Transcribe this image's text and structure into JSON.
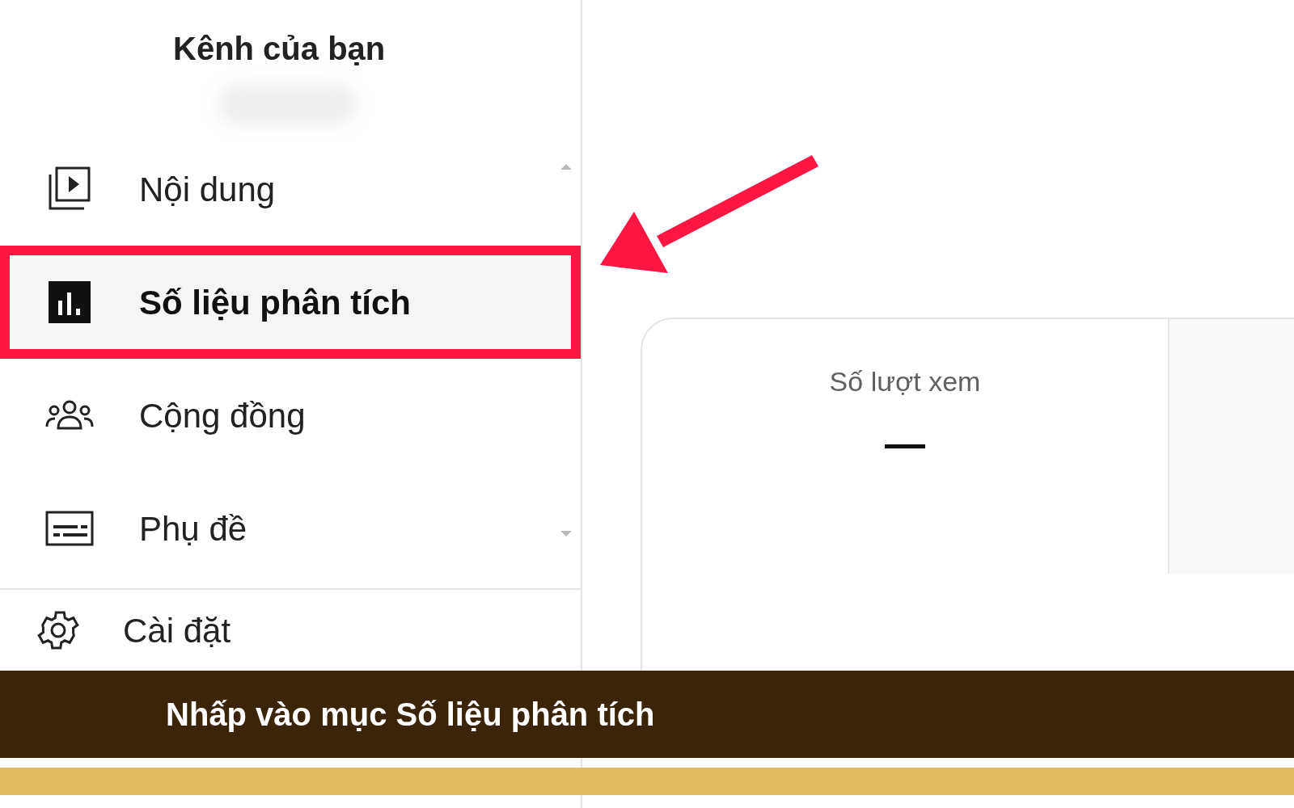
{
  "sidebar": {
    "title": "Kênh của bạn",
    "items": [
      {
        "kind": "content",
        "label": "Nội dung",
        "selected": false
      },
      {
        "kind": "analytics",
        "label": "Số liệu phân tích",
        "selected": true
      },
      {
        "kind": "community",
        "label": "Cộng đồng",
        "selected": false
      },
      {
        "kind": "subtitles",
        "label": "Phụ đề",
        "selected": false
      }
    ],
    "settings": {
      "label": "Cài đặt"
    }
  },
  "card": {
    "title": "Số lượt xem",
    "value": "—"
  },
  "caption": "Nhấp vào mục Số liệu phân tích"
}
